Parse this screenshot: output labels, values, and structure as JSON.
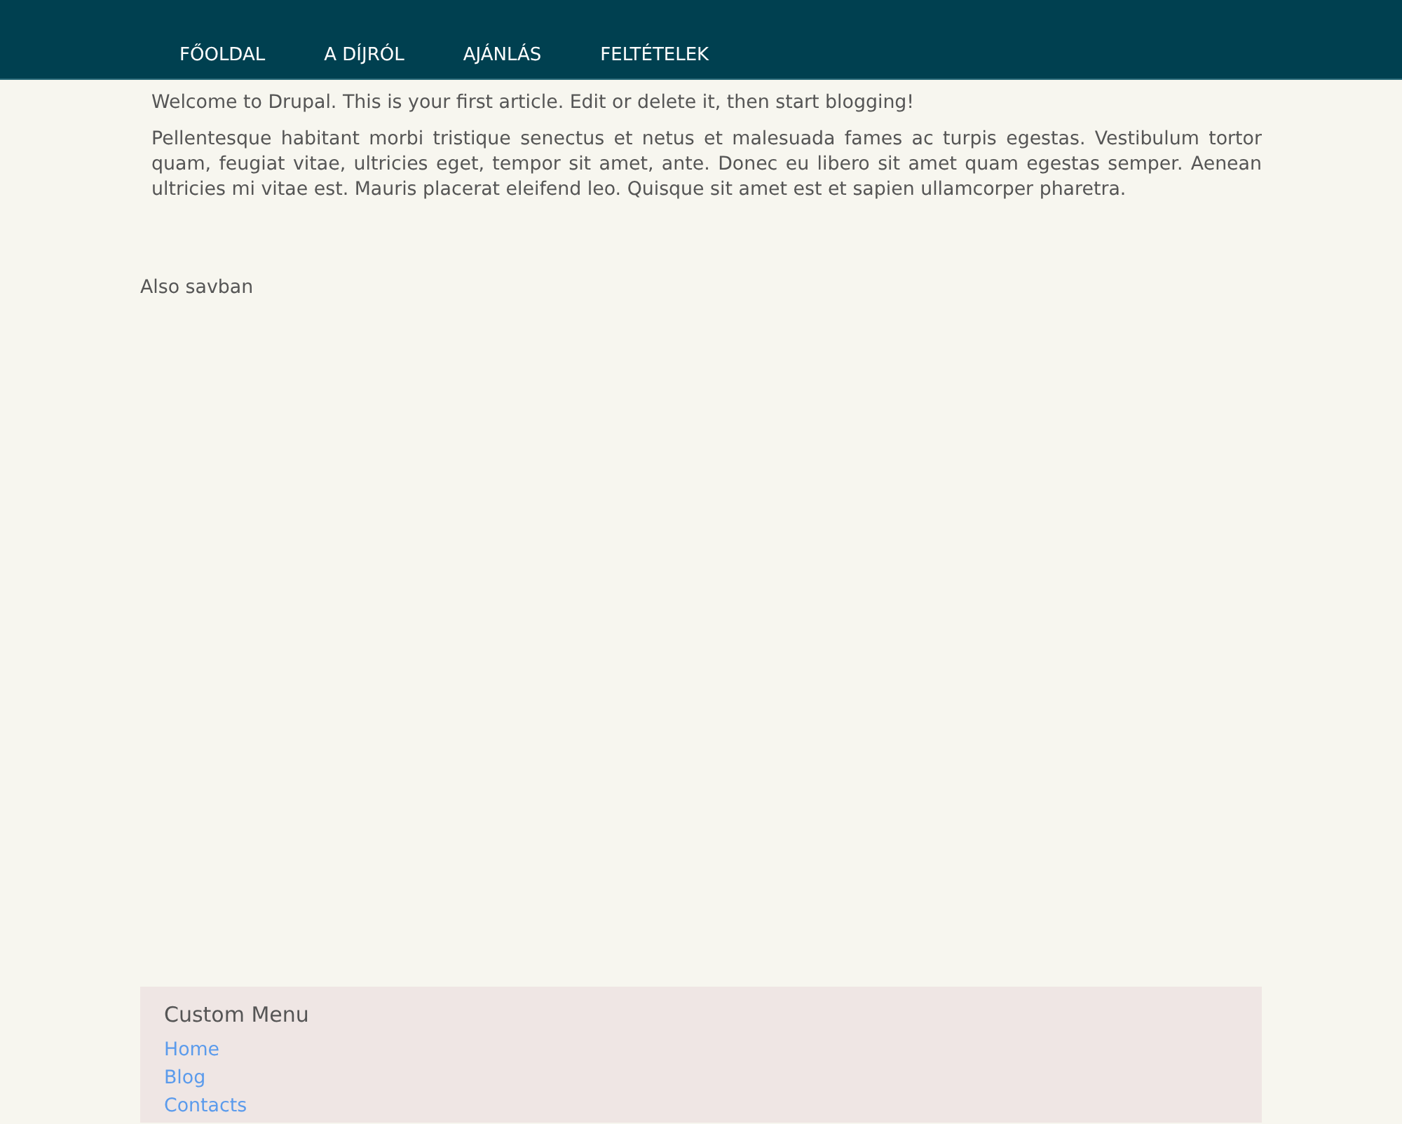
{
  "nav": {
    "items": [
      "FŐOLDAL",
      "A DÍJRÓL",
      "AJÁNLÁS",
      "FELTÉTELEK"
    ]
  },
  "article": {
    "intro": "Welcome to Drupal. This is your first article. Edit or delete it, then start blogging!",
    "body": "Pellentesque habitant morbi tristique senectus et netus et malesuada fames ac turpis egestas. Vestibulum tortor quam, feugiat vitae, ultricies eget, tempor sit amet, ante. Donec eu libero sit amet quam egestas semper. Aenean ultricies mi vitae est. Mauris placerat eleifend leo. Quisque sit amet est et sapien ullamcorper pharetra."
  },
  "region_label": "Also savban",
  "custom_menu": {
    "title": "Custom Menu",
    "links": [
      "Home",
      "Blog",
      "Contacts"
    ]
  }
}
